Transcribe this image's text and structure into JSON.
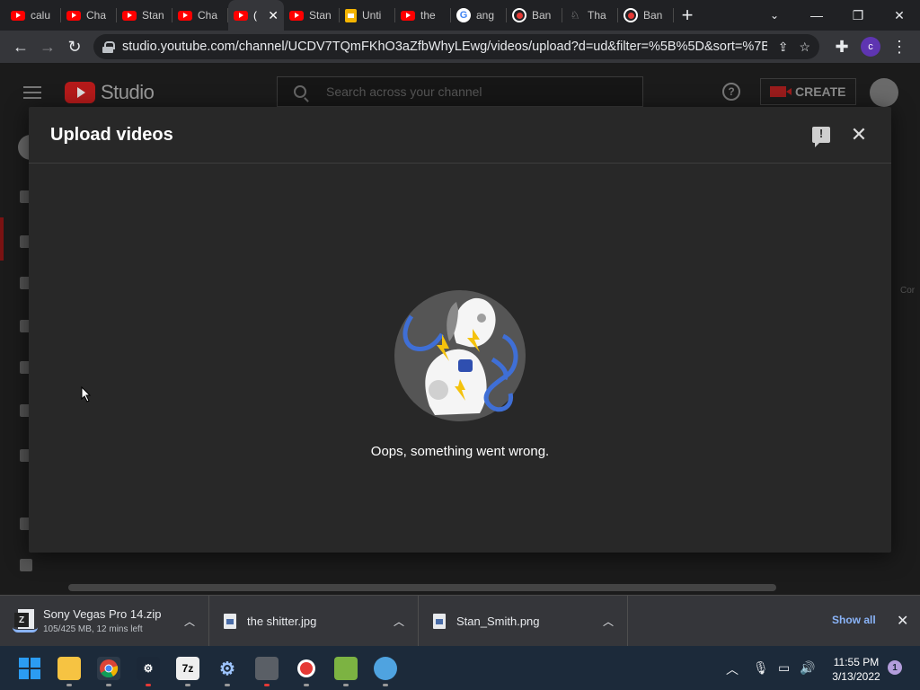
{
  "browser": {
    "tabs": [
      {
        "label": "calu",
        "icon": "youtube-icon"
      },
      {
        "label": "Cha",
        "icon": "youtube-icon"
      },
      {
        "label": "Stan",
        "icon": "youtube-icon"
      },
      {
        "label": "Cha",
        "icon": "youtube-icon"
      },
      {
        "label": "(",
        "icon": "youtube-icon",
        "active": true
      },
      {
        "label": "Stan",
        "icon": "youtube-icon"
      },
      {
        "label": "Unti",
        "icon": "slides-icon"
      },
      {
        "label": "the",
        "icon": "youtube-icon"
      },
      {
        "label": "ang",
        "icon": "google-icon"
      },
      {
        "label": "Ban",
        "icon": "record-icon"
      },
      {
        "label": "Tha",
        "icon": "figure-icon"
      },
      {
        "label": "Ban",
        "icon": "record-icon"
      }
    ],
    "url": "studio.youtube.com/channel/UCDV7TQmFKhO3aZfbWhyLEwg/videos/upload?d=ud&filter=%5B%5D&sort=%7B...",
    "profile_initial": "c"
  },
  "studio": {
    "logo_text": "Studio",
    "search_placeholder": "Search across your channel",
    "create_label": "CREATE",
    "ghost_text": "Cor"
  },
  "dialog": {
    "title": "Upload videos",
    "error_message": "Oops, something went wrong."
  },
  "downloads": {
    "items": [
      {
        "name": "Sony Vegas Pro 14.zip",
        "status": "105/425 MB, 12 mins left",
        "icon": "zip-icon"
      },
      {
        "name": "the shitter.jpg",
        "status": "",
        "icon": "image-file-icon"
      },
      {
        "name": "Stan_Smith.png",
        "status": "",
        "icon": "image-file-icon"
      }
    ],
    "show_all_label": "Show all"
  },
  "taskbar": {
    "time": "11:55 PM",
    "date": "3/13/2022",
    "notification_count": "1",
    "apps": [
      "windows-start",
      "file-explorer",
      "chrome",
      "steam",
      "7zip",
      "settings",
      "app-installer",
      "obs",
      "notepad-plus",
      "paint"
    ]
  },
  "colors": {
    "youtube_red": "#ff0000",
    "dialog_bg": "#282828",
    "link_blue": "#8ab4f8"
  }
}
